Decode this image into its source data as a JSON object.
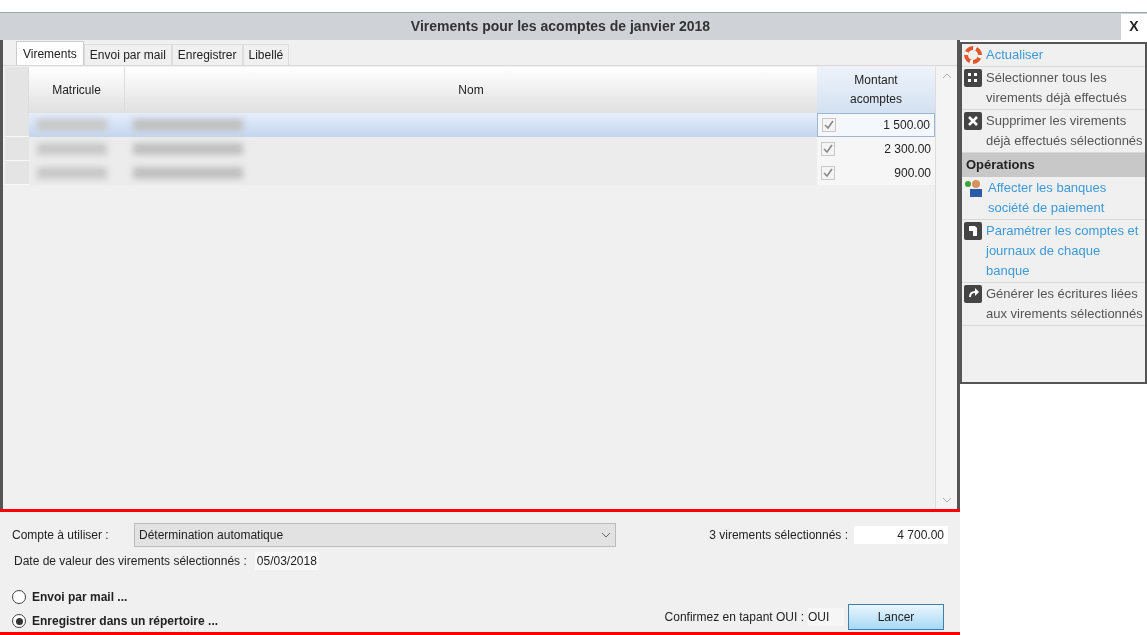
{
  "window": {
    "title": "Virements pour les acomptes de janvier 2018",
    "close": "X"
  },
  "tabs": [
    {
      "label": "Virements",
      "selected": true
    },
    {
      "label": "Envoi par mail",
      "selected": false
    },
    {
      "label": "Enregistrer",
      "selected": false
    },
    {
      "label": "Libellé",
      "selected": false
    }
  ],
  "table": {
    "columns": [
      "Matricule",
      "Nom",
      "Montant acomptes"
    ],
    "rows": [
      {
        "selected": true,
        "checked": true,
        "amount": "1 500.00"
      },
      {
        "selected": false,
        "checked": true,
        "amount": "2 300.00"
      },
      {
        "selected": false,
        "checked": true,
        "amount": "900.00"
      }
    ]
  },
  "form": {
    "account_label": "Compte à utiliser :",
    "account_value": "Détermination automatique",
    "count_label": "3 virements sélectionnés :",
    "total": "4 700.00",
    "date_label": "Date de valeur des virements sélectionnés :",
    "date_value": "05/03/2018",
    "options": [
      {
        "label": "Envoi par mail ...",
        "selected": false
      },
      {
        "label": "Enregistrer dans un répertoire ...",
        "selected": true
      }
    ],
    "confirm_label": "Confirmez en tapant OUI :",
    "confirm_value": "OUI",
    "run_button": "Lancer"
  },
  "side_panel": {
    "items": [
      {
        "kind": "link",
        "label": "Actualiser"
      },
      {
        "kind": "action",
        "label": "Sélectionner tous les virements déjà effectués"
      },
      {
        "kind": "action",
        "label": "Supprimer les virements déjà effectués sélectionnés"
      },
      {
        "kind": "header",
        "label": "Opérations"
      },
      {
        "kind": "link",
        "label": "Affecter les banques société de paiement"
      },
      {
        "kind": "link",
        "label": "Paramétrer les comptes et journaux de chaque banque"
      },
      {
        "kind": "action",
        "label": "Générer les écritures liées aux virements sélectionnés"
      }
    ]
  }
}
